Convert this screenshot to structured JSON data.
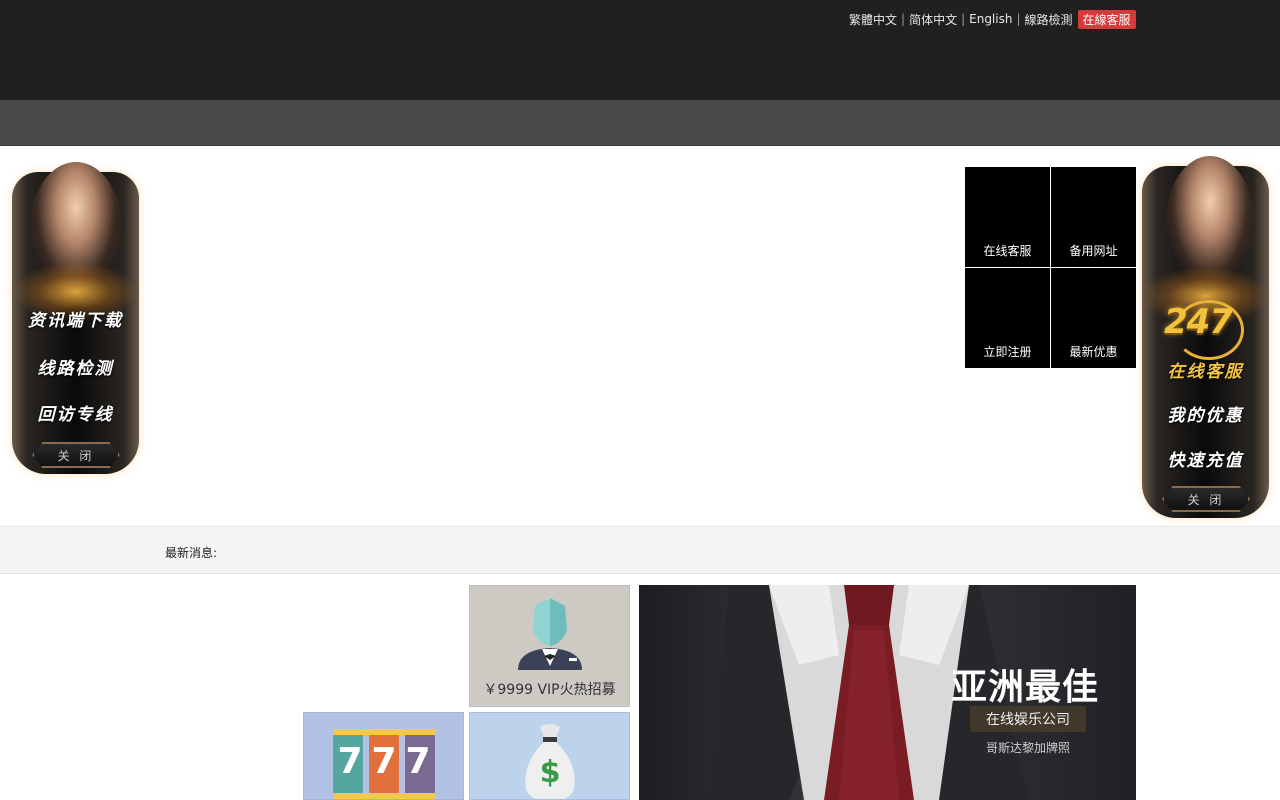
{
  "header": {
    "languages": [
      {
        "label": "繁體中文"
      },
      {
        "label": "简体中文"
      },
      {
        "label": "English"
      },
      {
        "label": "線路檢測"
      }
    ],
    "live_chat_label": "在線客服"
  },
  "quick_links": [
    {
      "label": "在线客服"
    },
    {
      "label": "备用网址"
    },
    {
      "label": "立即注册"
    },
    {
      "label": "最新优惠"
    }
  ],
  "left_float_panel": {
    "items": [
      {
        "label": "资讯端下载"
      },
      {
        "label": "线路检测"
      },
      {
        "label": "回访专线"
      }
    ],
    "close_label": "关 闭"
  },
  "right_float_panel": {
    "badge": "247",
    "items": [
      {
        "label": "在线客服"
      },
      {
        "label": "我的优惠"
      },
      {
        "label": "快速充值"
      }
    ],
    "close_label": "关 闭"
  },
  "news": {
    "label": "最新消息:"
  },
  "tiles": {
    "vip": {
      "caption": "￥9999 VIP火热招募"
    },
    "slots": {
      "symbols": "777"
    },
    "money": {
      "symbol": "$"
    }
  },
  "banner": {
    "title": "亚洲最佳",
    "subtitle": "在线娱乐公司",
    "license": "哥斯达黎加牌照"
  },
  "colors": {
    "header_bg": "#202020",
    "nav_bg": "#4a4a4a",
    "live_chat_bg": "#d63a3a",
    "tie": "#7a1c24"
  }
}
